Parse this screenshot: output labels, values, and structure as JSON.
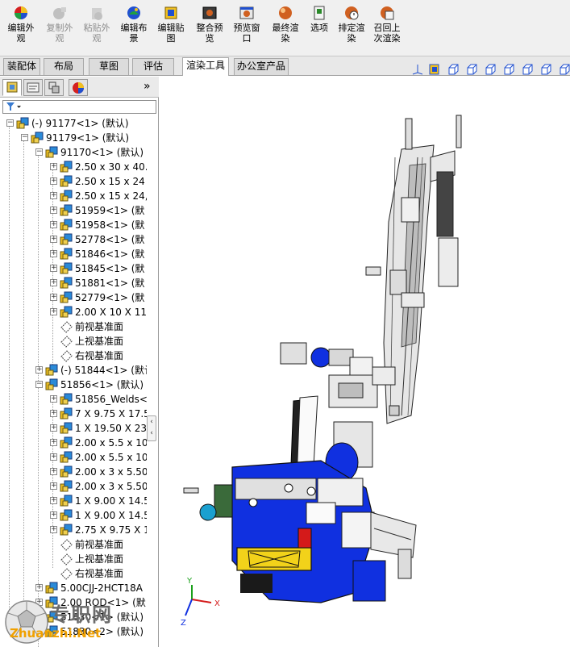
{
  "toolbar": {
    "buttons": [
      {
        "label": "编辑外\n观",
        "icon": "color-wheel-icon",
        "enabled": true
      },
      {
        "label": "复制外\n观",
        "icon": "copy-appearance-icon",
        "enabled": false
      },
      {
        "label": "粘贴外\n观",
        "icon": "paste-appearance-icon",
        "enabled": false
      },
      {
        "label": "编辑布\n景",
        "icon": "edit-scene-icon",
        "enabled": true
      },
      {
        "label": "编辑贴\n图",
        "icon": "edit-decal-icon",
        "enabled": true
      },
      {
        "label": "整合预\n览",
        "icon": "integrated-preview-icon",
        "enabled": true
      },
      {
        "label": "预览窗\n口",
        "icon": "preview-window-icon",
        "enabled": true
      },
      {
        "label": "最终渲\n染",
        "icon": "final-render-icon",
        "enabled": true
      },
      {
        "label": "选项",
        "icon": "options-icon",
        "enabled": true
      },
      {
        "label": "排定渲\n染",
        "icon": "schedule-render-icon",
        "enabled": true
      },
      {
        "label": "召回上\n次渲染",
        "icon": "recall-render-icon",
        "enabled": true
      }
    ]
  },
  "tabs": [
    {
      "label": "装配体",
      "active": false
    },
    {
      "label": "布局",
      "active": false
    },
    {
      "label": "草图",
      "active": false
    },
    {
      "label": "评估",
      "active": false
    },
    {
      "label": "渲染工具",
      "active": true
    },
    {
      "label": "办公室产品",
      "active": false
    }
  ],
  "panel": {
    "collapse_glyph": "»",
    "filter_glyph": "▼"
  },
  "tree": [
    {
      "level": 0,
      "expander": "−",
      "icon": "assembly",
      "label": "(-) 91177<1> (默认)"
    },
    {
      "level": 1,
      "expander": "−",
      "icon": "assembly",
      "label": "91179<1> (默认)"
    },
    {
      "level": 2,
      "expander": "−",
      "icon": "assembly",
      "label": "91170<1> (默认)"
    },
    {
      "level": 3,
      "expander": "+",
      "icon": "assembly",
      "label": "2.50 x 30 x 40."
    },
    {
      "level": 3,
      "expander": "+",
      "icon": "assembly",
      "label": "2.50 x 15 x 24"
    },
    {
      "level": 3,
      "expander": "+",
      "icon": "assembly",
      "label": "2.50 x 15 x 24,"
    },
    {
      "level": 3,
      "expander": "+",
      "icon": "assembly",
      "label": "51959<1> (默"
    },
    {
      "level": 3,
      "expander": "+",
      "icon": "assembly",
      "label": "51958<1> (默"
    },
    {
      "level": 3,
      "expander": "+",
      "icon": "assembly",
      "label": "52778<1> (默"
    },
    {
      "level": 3,
      "expander": "+",
      "icon": "assembly",
      "label": "51846<1> (默"
    },
    {
      "level": 3,
      "expander": "+",
      "icon": "assembly",
      "label": "51845<1> (默"
    },
    {
      "level": 3,
      "expander": "+",
      "icon": "assembly",
      "label": "51881<1> (默"
    },
    {
      "level": 3,
      "expander": "+",
      "icon": "assembly",
      "label": "52779<1> (默"
    },
    {
      "level": 3,
      "expander": "+",
      "icon": "assembly",
      "label": "2.00 X 10 X 11"
    },
    {
      "level": 3,
      "expander": "",
      "icon": "plane",
      "label": "前视基准面"
    },
    {
      "level": 3,
      "expander": "",
      "icon": "plane",
      "label": "上视基准面"
    },
    {
      "level": 3,
      "expander": "",
      "icon": "plane",
      "label": "右视基准面"
    },
    {
      "level": 2,
      "expander": "+",
      "icon": "assembly-warn",
      "label": "(-) 51844<1> (默认"
    },
    {
      "level": 2,
      "expander": "−",
      "icon": "assembly",
      "label": "51856<1> (默认)"
    },
    {
      "level": 3,
      "expander": "+",
      "icon": "assembly",
      "label": "51856_Welds<"
    },
    {
      "level": 3,
      "expander": "+",
      "icon": "assembly",
      "label": "7 X 9.75 X 17.5"
    },
    {
      "level": 3,
      "expander": "+",
      "icon": "assembly",
      "label": "1 X 19.50 X 23"
    },
    {
      "level": 3,
      "expander": "+",
      "icon": "assembly",
      "label": "2.00 x 5.5 x 10"
    },
    {
      "level": 3,
      "expander": "+",
      "icon": "assembly",
      "label": "2.00 x 5.5 x 10"
    },
    {
      "level": 3,
      "expander": "+",
      "icon": "assembly",
      "label": "2.00 x 3 x 5.50"
    },
    {
      "level": 3,
      "expander": "+",
      "icon": "assembly",
      "label": "2.00 x 3 x 5.50"
    },
    {
      "level": 3,
      "expander": "+",
      "icon": "assembly",
      "label": "1 X 9.00 X 14.5"
    },
    {
      "level": 3,
      "expander": "+",
      "icon": "assembly",
      "label": "1 X 9.00 X 14.5"
    },
    {
      "level": 3,
      "expander": "+",
      "icon": "assembly",
      "label": "2.75 X 9.75 X 1"
    },
    {
      "level": 3,
      "expander": "",
      "icon": "plane",
      "label": "前视基准面"
    },
    {
      "level": 3,
      "expander": "",
      "icon": "plane",
      "label": "上视基准面"
    },
    {
      "level": 3,
      "expander": "",
      "icon": "plane",
      "label": "右视基准面"
    },
    {
      "level": 2,
      "expander": "+",
      "icon": "assembly",
      "label": "5.00CJJ-2HCT18A"
    },
    {
      "level": 2,
      "expander": "+",
      "icon": "assembly",
      "label": "2.00 ROD<1> (默"
    },
    {
      "level": 2,
      "expander": "+",
      "icon": "assembly",
      "label": "51830<1> (默认)"
    },
    {
      "level": 2,
      "expander": "+",
      "icon": "assembly",
      "label": "51830<2> (默认)"
    }
  ],
  "triad": {
    "x_label": "X",
    "y_label": "Y",
    "z_label": "Z"
  },
  "watermark": {
    "main": "专职网",
    "url": "Zhuanzhi.Net"
  },
  "colors": {
    "machine_blue": "#1030e0",
    "machine_grey": "#c8c8c8",
    "highlight_yellow": "#f2d21a",
    "accent_red": "#d41a1a",
    "watermark_orange": "#f0a000"
  }
}
